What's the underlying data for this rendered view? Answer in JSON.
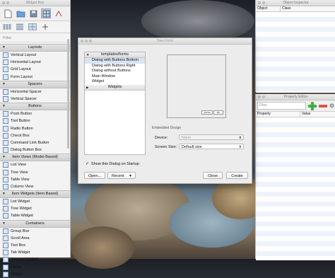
{
  "widget_box": {
    "title": "Widget Box",
    "filter_placeholder": "Filter",
    "categories": [
      {
        "label": "Layouts",
        "items": [
          "Vertical Layout",
          "Horizontal Layout",
          "Grid Layout",
          "Form Layout"
        ]
      },
      {
        "label": "Spacers",
        "items": [
          "Horizontal Spacer",
          "Vertical Spacer"
        ]
      },
      {
        "label": "Buttons",
        "items": [
          "Push Button",
          "Tool Button",
          "Radio Button",
          "Check Box",
          "Command Link Button",
          "Dialog Button Box"
        ]
      },
      {
        "label": "Item Views (Model-Based)",
        "items": [
          "List View",
          "Tree View",
          "Table View",
          "Column View"
        ]
      },
      {
        "label": "Item Widgets (Item-Based)",
        "items": [
          "List Widget",
          "Tree Widget",
          "Table Widget"
        ]
      },
      {
        "label": "Containers",
        "items": [
          "Group Box",
          "Scroll Area",
          "Tool Box",
          "Tab Widget",
          "Stacked Widget",
          "Frame",
          "Widget"
        ]
      }
    ]
  },
  "object_inspector": {
    "title": "Object Inspector",
    "col_object": "Object",
    "col_class": "Class"
  },
  "property_editor": {
    "title": "Property Editor",
    "filter_placeholder": "Filter",
    "col_property": "Property",
    "col_value": "Value",
    "add_icon_color": "#3cb043",
    "remove_icon_color": "#d9534f"
  },
  "new_form": {
    "title": "New Form",
    "tree_templates_label": "templates/forms",
    "templates": [
      "Dialog with Buttons Bottom",
      "Dialog with Buttons Right",
      "Dialog without Buttons",
      "Main Window",
      "Widget"
    ],
    "selected_index": 0,
    "tree_widgets_label": "Widgets",
    "preview_cancel": "Cancel",
    "preview_ok": "OK",
    "embedded_design_label": "Embedded Design",
    "device_label": "Device:",
    "device_value": "None",
    "screen_size_label": "Screen Size:",
    "screen_size_value": "Default size",
    "show_dialog_label": "Show this Dialog on Startup",
    "show_dialog_checked": true,
    "buttons": {
      "open": "Open...",
      "recent": "Recent",
      "close": "Close",
      "create": "Create"
    }
  }
}
